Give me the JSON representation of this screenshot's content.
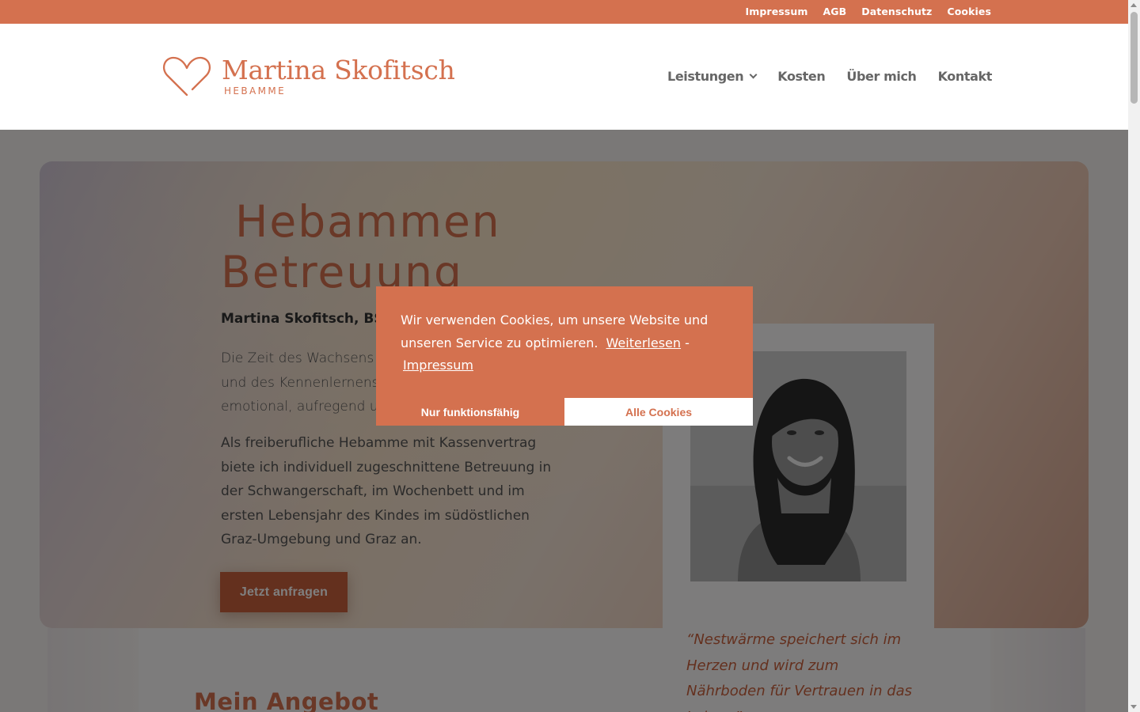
{
  "topbar": {
    "links": [
      "Impressum",
      "AGB",
      "Datenschutz",
      "Cookies"
    ]
  },
  "brand": {
    "name": "Martina Skofitsch",
    "subtitle": "HEBAMME"
  },
  "nav": {
    "items": [
      "Leistungen",
      "Kosten",
      "Über mich",
      "Kontakt"
    ]
  },
  "hero": {
    "title_line1": "Hebammen",
    "title_line2": "Betreuung",
    "subtitle": "Martina Skofitsch, BSc",
    "p1": "Die Zeit des Wachsens in der Schwangerschaft und des Kennenlernens danach ist aufregend, emotional, aufregend und wunderschön.",
    "p2": "Als freiberufliche Hebamme mit Kassenvertrag biete ich individuell zugeschnittene Betreuung in der Schwangerschaft, im Wochenbett und im ersten Lebensjahr des Kindes im südöstlichen Graz-Umgebung und Graz an.",
    "cta": "Jetzt anfragen"
  },
  "quote": {
    "text": "“Nestwärme speichert sich im Herzen und wird zum Nährboden für Vertrauen in das Leben.”"
  },
  "section": {
    "heading": "Mein Angebot"
  },
  "cookie": {
    "text": "Wir verwenden Cookies, um unsere Website und unseren Service zu optimieren.",
    "link_more": "Weiterlesen",
    "separator": " - ",
    "link_impressum": "Impressum",
    "btn_functional": "Nur funktionsfähig",
    "btn_all": "Alle Cookies"
  },
  "colors": {
    "accent": "#d4714f",
    "accent_dark": "#c9603d"
  }
}
